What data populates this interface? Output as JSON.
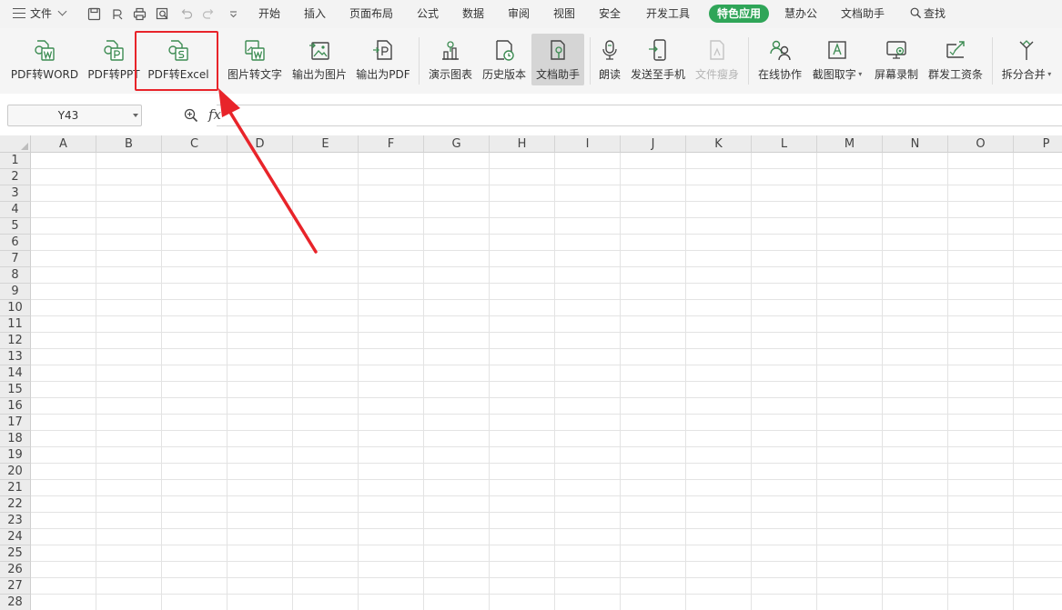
{
  "menubar": {
    "file_label": "文件",
    "find_label": "查找",
    "tabs": [
      {
        "label": "开始"
      },
      {
        "label": "插入"
      },
      {
        "label": "页面布局"
      },
      {
        "label": "公式"
      },
      {
        "label": "数据"
      },
      {
        "label": "审阅"
      },
      {
        "label": "视图"
      },
      {
        "label": "安全"
      },
      {
        "label": "开发工具"
      },
      {
        "label": "特色应用",
        "active": true
      },
      {
        "label": "慧办公"
      },
      {
        "label": "文档助手"
      }
    ]
  },
  "ribbon": {
    "buttons": [
      {
        "label": "PDF转WORD",
        "icon": "pdf-to-word-icon"
      },
      {
        "label": "PDF转PPT",
        "icon": "pdf-to-ppt-icon"
      },
      {
        "label": "PDF转Excel",
        "icon": "pdf-to-excel-icon"
      },
      {
        "label": "图片转文字",
        "icon": "image-to-text-icon"
      },
      {
        "label": "输出为图片",
        "icon": "export-image-icon"
      },
      {
        "label": "输出为PDF",
        "icon": "export-pdf-icon"
      },
      {
        "label": "演示图表",
        "icon": "demo-chart-icon"
      },
      {
        "label": "历史版本",
        "icon": "history-version-icon"
      },
      {
        "label": "文档助手",
        "icon": "doc-assistant-icon"
      },
      {
        "label": "朗读",
        "icon": "read-aloud-icon"
      },
      {
        "label": "发送至手机",
        "icon": "send-to-phone-icon"
      },
      {
        "label": "文件瘦身",
        "icon": "file-slim-icon"
      },
      {
        "label": "在线协作",
        "icon": "online-collab-icon"
      },
      {
        "label": "截图取字",
        "icon": "screenshot-ocr-icon"
      },
      {
        "label": "屏幕录制",
        "icon": "screen-record-icon"
      },
      {
        "label": "群发工资条",
        "icon": "payslip-icon"
      },
      {
        "label": "拆分合并",
        "icon": "split-merge-icon"
      }
    ]
  },
  "formula_bar": {
    "cell_ref": "Y43",
    "fx": "fx"
  },
  "sheet": {
    "columns": [
      "A",
      "B",
      "C",
      "D",
      "E",
      "F",
      "G",
      "H",
      "I",
      "J",
      "K",
      "L",
      "M",
      "N",
      "O",
      "P"
    ],
    "rows": [
      "1",
      "2",
      "3",
      "4",
      "5",
      "6",
      "7",
      "8",
      "9",
      "10",
      "11",
      "12",
      "13",
      "14",
      "15",
      "16",
      "17",
      "18",
      "19",
      "20",
      "21",
      "22",
      "23",
      "24",
      "25",
      "26",
      "27",
      "28"
    ]
  },
  "colors": {
    "accent_green": "#2fa558",
    "annotation_red": "#e8242a"
  }
}
